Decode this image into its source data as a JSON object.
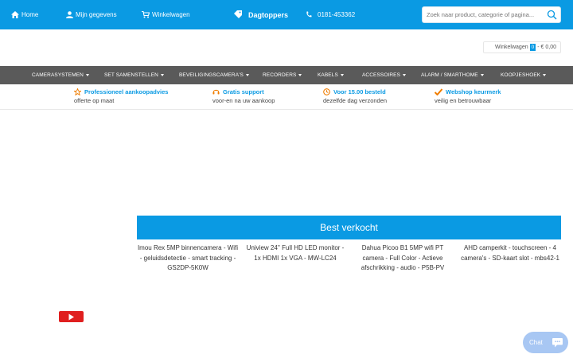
{
  "topnav": {
    "home_label": "Home",
    "account_label": "Mijn gegevens",
    "cart_label": "Winkelwagen",
    "deals_label": "Dagtoppers",
    "phone": "0181-453362"
  },
  "search": {
    "placeholder": "Zoek naar product, categorie of pagina..."
  },
  "cart_summary": {
    "label": "Winkelwagen",
    "count": "0",
    "total": "- € 0,00"
  },
  "categories": [
    "CAMERASYSTEMEN",
    "SET SAMENSTELLEN",
    "BEVEILIGINGSCAMERA'S",
    "RECORDERS",
    "KABELS",
    "ACCESSOIRES",
    "ALARM / SMARTHOME",
    "KOOPJESHOEK"
  ],
  "usps": [
    {
      "title": "Professioneel aankoopadvies",
      "subtitle": "offerte op maat",
      "icon": "star-icon"
    },
    {
      "title": "Gratis support",
      "subtitle": "voor-en na uw aankoop",
      "icon": "headset-icon"
    },
    {
      "title": "Voor 15.00 besteld",
      "subtitle": "dezelfde dag verzonden",
      "icon": "clock-icon"
    },
    {
      "title": "Webshop keurmerk",
      "subtitle": "veilig en betrouwbaar",
      "icon": "check-icon"
    }
  ],
  "bestsellers": {
    "title": "Best verkocht",
    "products": [
      "Imou Rex 5MP binnencamera - Wifi - geluidsdetectie - smart tracking - GS2DP-5K0W",
      "Uniview 24'' Full HD LED monitor - 1x HDMI 1x VGA - MW-LC24",
      "Dahua Picoo B1 5MP wifi PT camera - Full Color - Actieve afschrikking - audio - P5B-PV",
      "AHD camperkit - touchscreen - 4 camera's - SD-kaart slot - mbs42-1"
    ]
  },
  "chat": {
    "label": "Chat"
  },
  "colors": {
    "brand_blue": "#0a9ae3",
    "nav_gray": "#5a5a5a",
    "chat_bg": "#a8c7f3",
    "youtube_red": "#e01f1f"
  }
}
